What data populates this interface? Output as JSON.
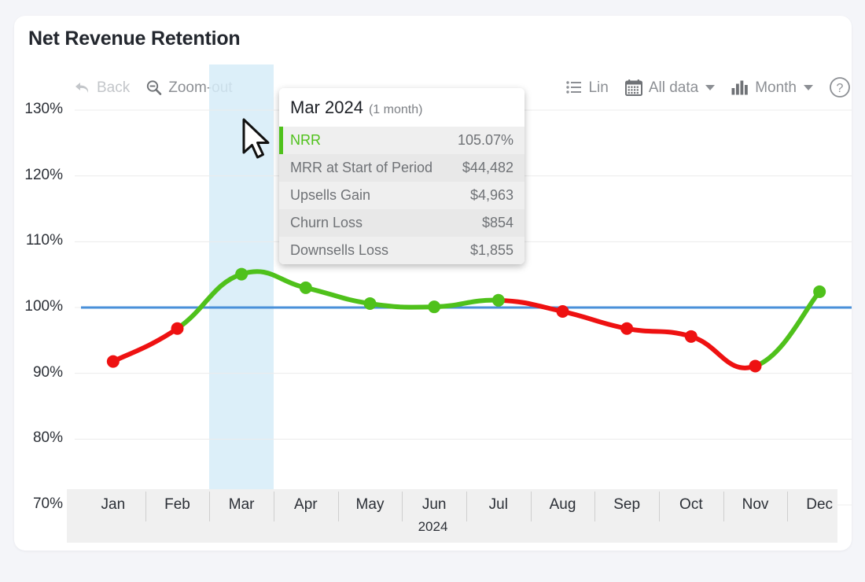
{
  "page": {
    "background": "#f4f5f9",
    "card_background": "#ffffff"
  },
  "header": {
    "title": "Net Revenue Retention"
  },
  "toolbar": {
    "back_label": "Back",
    "zoom_out_label": "Zoom-out",
    "scale_label": "Lin",
    "range_label": "All data",
    "granularity_label": "Month",
    "help_label": "?"
  },
  "tooltip": {
    "title": "Mar 2024",
    "subtitle": "(1 month)",
    "accent_color": "#4fc11b",
    "rows": [
      {
        "label": "NRR",
        "value": "105.07%"
      },
      {
        "label": "MRR at Start of Period",
        "value": "$44,482"
      },
      {
        "label": "Upsells Gain",
        "value": "$4,963"
      },
      {
        "label": "Churn Loss",
        "value": "$854"
      },
      {
        "label": "Downsells Loss",
        "value": "$1,855"
      }
    ]
  },
  "axis": {
    "year": "2024",
    "y_ticks": [
      "130%",
      "120%",
      "110%",
      "100%",
      "90%",
      "80%",
      "70%"
    ],
    "x_ticks": [
      "Jan",
      "Feb",
      "Mar",
      "Apr",
      "May",
      "Jun",
      "Jul",
      "Aug",
      "Sep",
      "Oct",
      "Nov",
      "Dec"
    ]
  },
  "chart_data": {
    "type": "line",
    "title": "Net Revenue Retention",
    "xlabel": "2024",
    "ylabel": "",
    "ylim": [
      70,
      130
    ],
    "yticks": [
      70,
      80,
      90,
      100,
      110,
      120,
      130
    ],
    "ytick_labels": [
      "70%",
      "80%",
      "90%",
      "100%",
      "110%",
      "120%",
      "130%"
    ],
    "grid": true,
    "legend": false,
    "categories": [
      "Jan",
      "Feb",
      "Mar",
      "Apr",
      "May",
      "Jun",
      "Jul",
      "Aug",
      "Sep",
      "Oct",
      "Nov",
      "Dec"
    ],
    "series": [
      {
        "name": "NRR",
        "values": [
          91.8,
          96.8,
          105.07,
          103.0,
          100.6,
          100.1,
          101.1,
          99.4,
          96.8,
          95.6,
          91.1,
          102.4
        ],
        "point_colors": [
          "#ee1111",
          "#ee1111",
          "#4fc11b",
          "#4fc11b",
          "#4fc11b",
          "#4fc11b",
          "#4fc11b",
          "#ee1111",
          "#ee1111",
          "#ee1111",
          "#ee1111",
          "#4fc11b"
        ]
      }
    ],
    "reference_line": {
      "value": 100,
      "color": "#4a90d9",
      "label": "100%"
    },
    "colors": {
      "above": "#4fc11b",
      "below": "#ee1111"
    },
    "highlight": {
      "category": "Mar",
      "color": "#d6ecf8"
    },
    "annotations": [
      {
        "category": "Mar",
        "value": 105.07,
        "text": "Mar 2024 NRR 105.07%"
      }
    ]
  }
}
